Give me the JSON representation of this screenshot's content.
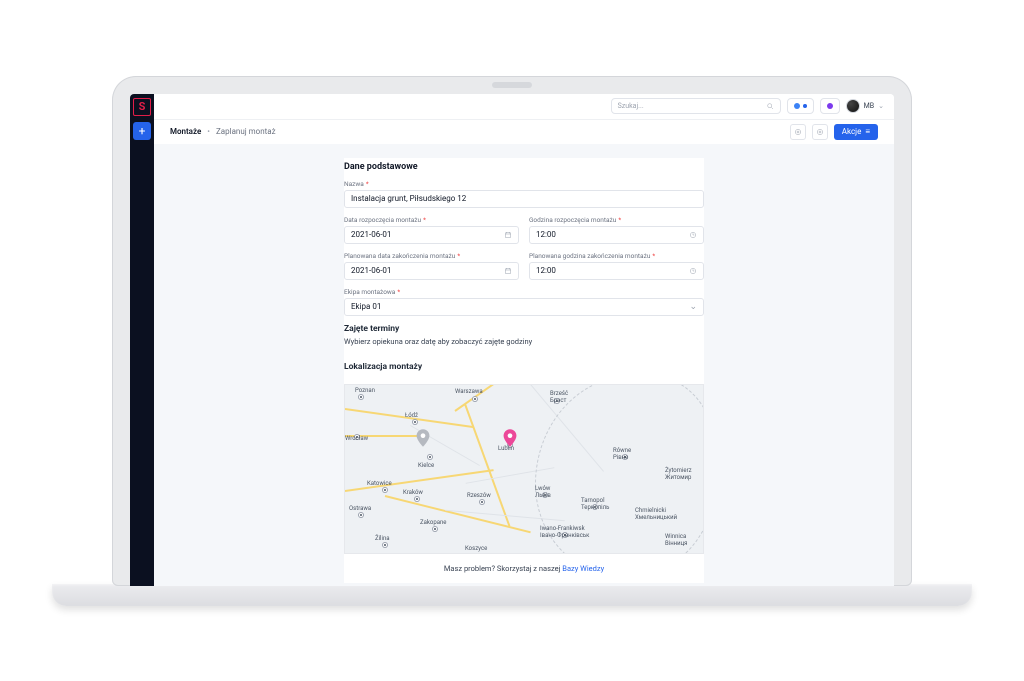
{
  "topbar": {
    "search_placeholder": "Szukaj...",
    "user_initials": "MB"
  },
  "breadcrumb": {
    "section": "Montaże",
    "page": "Zaplanuj montaż"
  },
  "actions": {
    "label": "Akcje"
  },
  "form": {
    "section_title": "Dane podstawowe",
    "fields": {
      "name": {
        "label": "Nazwa",
        "value": "Instalacja grunt, Piłsudskiego 12"
      },
      "start_date": {
        "label": "Data rozpoczęcia montażu",
        "value": "2021-06-01"
      },
      "start_time": {
        "label": "Godzina rozpoczęcia montażu",
        "value": "12:00"
      },
      "end_date": {
        "label": "Planowana data zakończenia montażu",
        "value": "2021-06-01"
      },
      "end_time": {
        "label": "Planowana godzina zakończenia montażu",
        "value": "12:00"
      },
      "team": {
        "label": "Ekipa montażowa",
        "value": "Ekipa 01"
      }
    }
  },
  "busy": {
    "title": "Zajęte terminy",
    "subtitle": "Wybierz opiekuna oraz datę aby zobaczyć zajęte godziny"
  },
  "map": {
    "title": "Lokalizacja montaży",
    "cities": {
      "poznan": "Poznan",
      "warszawa": "Warszawa",
      "brzesc": "Brześć",
      "lodz": "Łódź",
      "wroclaw": "Wrocław",
      "kielce": "Kielce",
      "katowice": "Katowice",
      "krakow": "Kraków",
      "rzeszow": "Rzeszów",
      "ostrawa": "Ostrawa",
      "zakopane": "Zakopane",
      "zilina": "Žilina",
      "koszyce": "Koszyce",
      "lwow": "Lwów\nЛьвів",
      "rowne": "Równe\nРівне",
      "zytomierz": "Żytomierz\nЖитомир",
      "tarnopol": "Tarnopol\nТернопіль",
      "chmielnicki": "Chmielnicki\nХмельницький",
      "winnica": "Winnica\nВінниця",
      "iwanofrankiwsk": "Iwano-Frankiwsk\nІвано-Франківськ",
      "lublin": "Lublin",
      "brest2": "Брэст"
    }
  },
  "help": {
    "prefix": "Masz problem? Skorzystaj z naszej ",
    "link": "Bazy Wiedzy"
  }
}
